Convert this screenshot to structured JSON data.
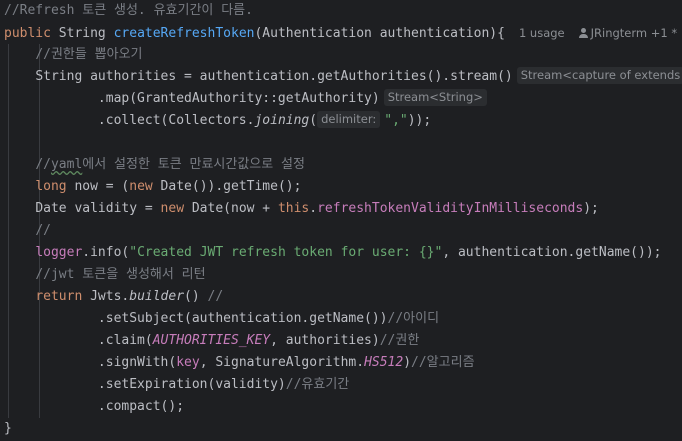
{
  "lines": {
    "l1_comment": "//Refresh 토큰 생성. 유효기간이 다름.",
    "l2_public": "public",
    "l2_string": " String ",
    "l2_method": "createRefreshToken",
    "l2_params": "(Authentication authentication){",
    "l2_usage": "1 usage",
    "l2_author": "JRingterm +1 *",
    "l3_comment": "//권한들 뽑아오기",
    "l4_code": "String authorities = authentication.getAuthorities().stream()",
    "l4_hint": "Stream<capture of extends",
    "l5_code": ".map(GrantedAuthority::getAuthority)",
    "l5_hint": "Stream<String>",
    "l6_a": ".collect(Collectors.",
    "l6_joining": "joining",
    "l6_b": "(",
    "l6_param": "delimiter:",
    "l6_str": "\",\"",
    "l6_c": "));",
    "l8_slashes": "//",
    "l8_yaml": "yaml",
    "l8_rest": "에서 설정한 토큰 만료시간값으로 설정",
    "l9_long": "long",
    "l9_a": " now = (",
    "l9_new": "new",
    "l9_b": " Date()).getTime();",
    "l10_a": "Date validity = ",
    "l10_new": "new",
    "l10_b": " Date(now + ",
    "l10_this": "this",
    "l10_dot": ".",
    "l10_field": "refreshTokenValidityInMilliseconds",
    "l10_c": ");",
    "l11_comment": "//",
    "l12_logger": "logger",
    "l12_a": ".info(",
    "l12_str": "\"Created JWT refresh token for user: {}\"",
    "l12_b": ", authentication.getName());",
    "l13_comment": "//jwt 토큰을 생성해서 리턴",
    "l14_return": "return",
    "l14_a": " Jwts.",
    "l14_builder": "builder",
    "l14_b": "() ",
    "l14_cm": "//",
    "l15_a": ".setSubject(authentication.getName())",
    "l15_cm": "//아이디",
    "l16_a": ".claim(",
    "l16_const": "AUTHORITIES_KEY",
    "l16_b": ", authorities)",
    "l16_cm": "//권한",
    "l17_a": ".signWith(",
    "l17_key": "key",
    "l17_b": ", SignatureAlgorithm.",
    "l17_hs": "HS512",
    "l17_c": ")",
    "l17_cm": "//알고리즘",
    "l18_a": ".setExpiration(validity)",
    "l18_cm": "//유효기간",
    "l19_a": ".compact();",
    "l20_brace": "}"
  },
  "colors": {
    "background": "#1e1f22",
    "keyword": "#cf8e6d",
    "method_decl": "#56a8f5",
    "comment": "#7a7e85",
    "string": "#6aab73",
    "field": "#c77dbb",
    "text": "#bcbec4"
  },
  "icons": {
    "author": "user-icon"
  }
}
